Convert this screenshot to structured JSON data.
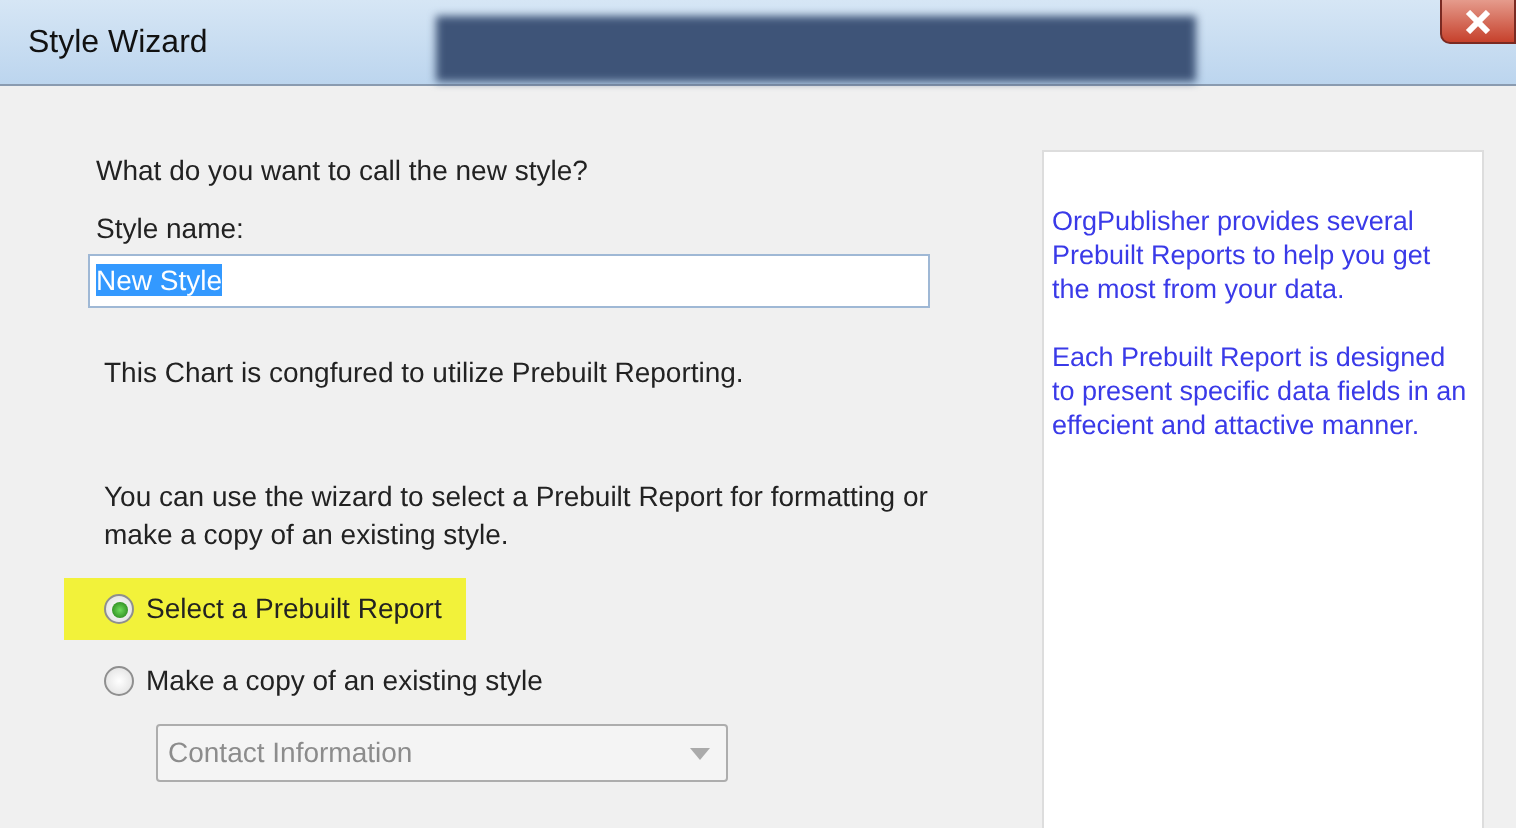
{
  "window": {
    "title": "Style Wizard",
    "blurred_title_area": true
  },
  "question": "What do you want to call the new style?",
  "style_name": {
    "label": "Style name:",
    "value": "New Style",
    "text_selected": true
  },
  "info_text": "This Chart is congfured to utilize Prebuilt Reporting.",
  "instructions": "You can use the wizard to select a Prebuilt Report for formatting or make a copy of an existing style.",
  "options": [
    {
      "label": "Select a Prebuilt Report",
      "selected": true,
      "highlighted": true
    },
    {
      "label": "Make a copy of an existing style",
      "selected": false,
      "highlighted": false
    }
  ],
  "style_dropdown": {
    "value": "Contact Information",
    "disabled": true
  },
  "help_panel": {
    "paragraphs": [
      "OrgPublisher provides several Prebuilt Reports to help you get the most from your data.",
      "Each Prebuilt Report is designed to present specific data fields in an effecient and attactive manner."
    ]
  }
}
